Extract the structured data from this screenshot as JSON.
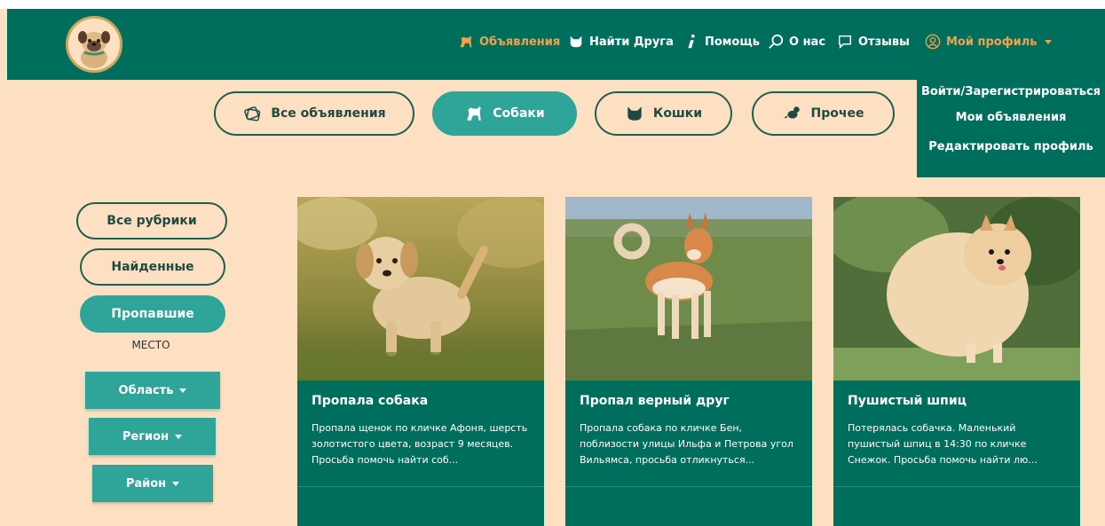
{
  "header": {
    "nav": [
      {
        "label": "Объявления",
        "icon": "dog-icon",
        "active": true
      },
      {
        "label": "Найти Друга",
        "icon": "cat-icon"
      },
      {
        "label": "Помощь",
        "icon": "info-icon"
      },
      {
        "label": "О нас",
        "icon": "search-icon"
      },
      {
        "label": "Отзывы",
        "icon": "chat-icon"
      },
      {
        "label": "Мой профиль",
        "icon": "user-icon"
      }
    ]
  },
  "profile_menu": [
    "Войти/Зарегистрироваться",
    "Мои объявления",
    "Редактировать профиль"
  ],
  "categories": [
    {
      "label": "Все объявления",
      "icon": "tag-icon"
    },
    {
      "label": "Собаки",
      "icon": "dog-icon",
      "selected": true
    },
    {
      "label": "Кошки",
      "icon": "cat-icon"
    },
    {
      "label": "Прочее",
      "icon": "bird-icon"
    }
  ],
  "sidebar": {
    "rubrics": [
      "Все рубрики",
      "Найденные",
      "Пропавшие"
    ],
    "selected_rubric": "Пропавшие",
    "place_label": "МЕСТО",
    "filters": [
      "Область",
      "Регион",
      "Район"
    ]
  },
  "cards": [
    {
      "title": "Пропала собака",
      "text": "Пропала щенок по кличке Афоня, шерсть золотистого цвета, возраст 9 месяцев. Просьба помочь найти соб..."
    },
    {
      "title": "Пропал верный друг",
      "text": "Пропала собака по кличке Бен, поблизости улицы Ильфа и Петрова угол Вильямса, просьба отликнуться..."
    },
    {
      "title": "Пушистый шпиц",
      "text": "Потерялась собачка. Маленький пушистый шпиц в 14:30 по кличке Снежок. Просьба помочь найти лю..."
    }
  ],
  "colors": {
    "header_bg": "#006e5c",
    "page_bg": "#fde0c1",
    "accent_teal": "#2fa498",
    "active_nav": "#f2a24a"
  }
}
